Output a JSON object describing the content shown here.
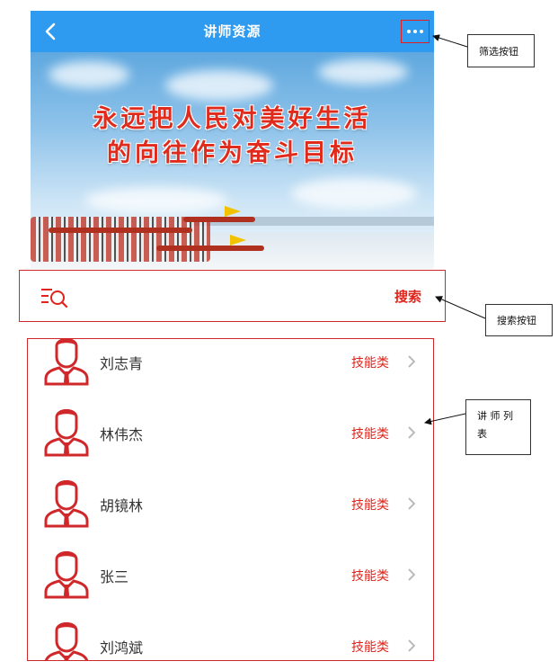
{
  "nav": {
    "title": "讲师资源"
  },
  "banner": {
    "line1": "永远把人民对美好生活",
    "line2": "的向往作为奋斗目标"
  },
  "search": {
    "label": "搜索"
  },
  "teachers": [
    {
      "name": "刘志青",
      "category": "技能类"
    },
    {
      "name": "林伟杰",
      "category": "技能类"
    },
    {
      "name": "胡镜林",
      "category": "技能类"
    },
    {
      "name": "张三",
      "category": "技能类"
    },
    {
      "name": "刘鸿斌",
      "category": "技能类"
    }
  ],
  "annotations": {
    "filter": "筛选按钮",
    "search": "搜索按钮",
    "list_line1": "讲 师 列",
    "list_line2": "表"
  },
  "colors": {
    "nav_blue": "#2f9bf0",
    "accent_red": "#e0241b",
    "annotation_border": "#d0282a"
  },
  "icons": [
    "back-arrow-icon",
    "more-dots-icon",
    "search-list-icon",
    "teacher-avatar-icon",
    "chevron-right-icon"
  ]
}
